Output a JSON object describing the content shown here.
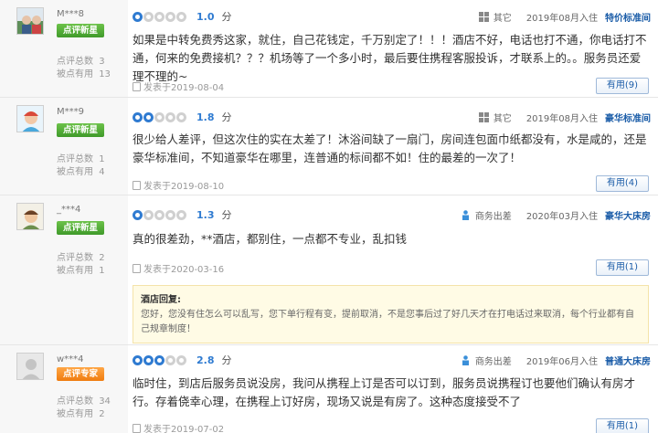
{
  "reviews": [
    {
      "user": "M***8",
      "badge": "点评新星",
      "review_count_label": "点评总数",
      "review_count": "3",
      "useful_label": "被点有用",
      "useful_count": "13",
      "score": "1.0",
      "score_unit": "分",
      "score_level": 1,
      "trip_type": "其它",
      "checkin": "2019年08月入住",
      "room": "特价标准间",
      "text": "如果是中转免费秀这家，就住，自己花钱定，千万别定了！！！酒店不好，电话也打不通，你电话打不通，何来的免费接机？？？机场等了一个多小时，最后要住携程客服投诉，才联系上的。。服务员还爱理不理的~",
      "date": "发表于2019-08-04",
      "useful_button": "有用(9)"
    },
    {
      "user": "M***9",
      "badge": "点评新星",
      "review_count_label": "点评总数",
      "review_count": "1",
      "useful_label": "被点有用",
      "useful_count": "4",
      "score": "1.8",
      "score_unit": "分",
      "score_level": 2,
      "trip_type": "其它",
      "checkin": "2019年08月入住",
      "room": "豪华标准间",
      "text": "很少给人差评，但这次住的实在太差了！沐浴间缺了一扇门，房间连包面巾纸都没有，水是咸的，还是豪华标准间，不知道豪华在哪里，连普通的标间都不如！住的最差的一次了！",
      "date": "发表于2019-08-10",
      "useful_button": "有用(4)"
    },
    {
      "user": "_***4",
      "badge": "点评新星",
      "review_count_label": "点评总数",
      "review_count": "2",
      "useful_label": "被点有用",
      "useful_count": "1",
      "score": "1.3",
      "score_unit": "分",
      "score_level": 1,
      "trip_type": "商务出差",
      "checkin": "2020年03月入住",
      "room": "豪华大床房",
      "text": "真的很差劲，**酒店，都别住，一点都不专业，乱扣钱",
      "date": "发表于2020-03-16",
      "useful_button": "有用(1)",
      "reply_title": "酒店回复:",
      "reply_text": "您好，您没有住怎么可以乱写，您下单行程有变，提前取消，不是您事后过了好几天才在打电话过来取消，每个行业都有自己规章制度！"
    },
    {
      "user": "w***4",
      "badge": "点评专家",
      "review_count_label": "点评总数",
      "review_count": "34",
      "useful_label": "被点有用",
      "useful_count": "2",
      "score": "2.8",
      "score_unit": "分",
      "score_level": 3,
      "trip_type": "商务出差",
      "checkin": "2019年06月入住",
      "room": "普通大床房",
      "text": "临时住，到店后服务员说没房，我问从携程上订是否可以订到，服务员说携程订也要他们确认有房才行。存着侥幸心理，在携程上订好房，现场又说是有房了。这种态度接受不了",
      "date": "发表于2019-07-02",
      "useful_button": "有用(1)"
    }
  ],
  "colors": {
    "accent": "#2f7bd1",
    "link": "#1a5ca8",
    "badge_green": "#4caf35",
    "badge_orange": "#f08a1c"
  },
  "icons": {
    "trip_other": "grid-icon",
    "trip_business": "person-tie-icon",
    "date": "document-icon"
  }
}
